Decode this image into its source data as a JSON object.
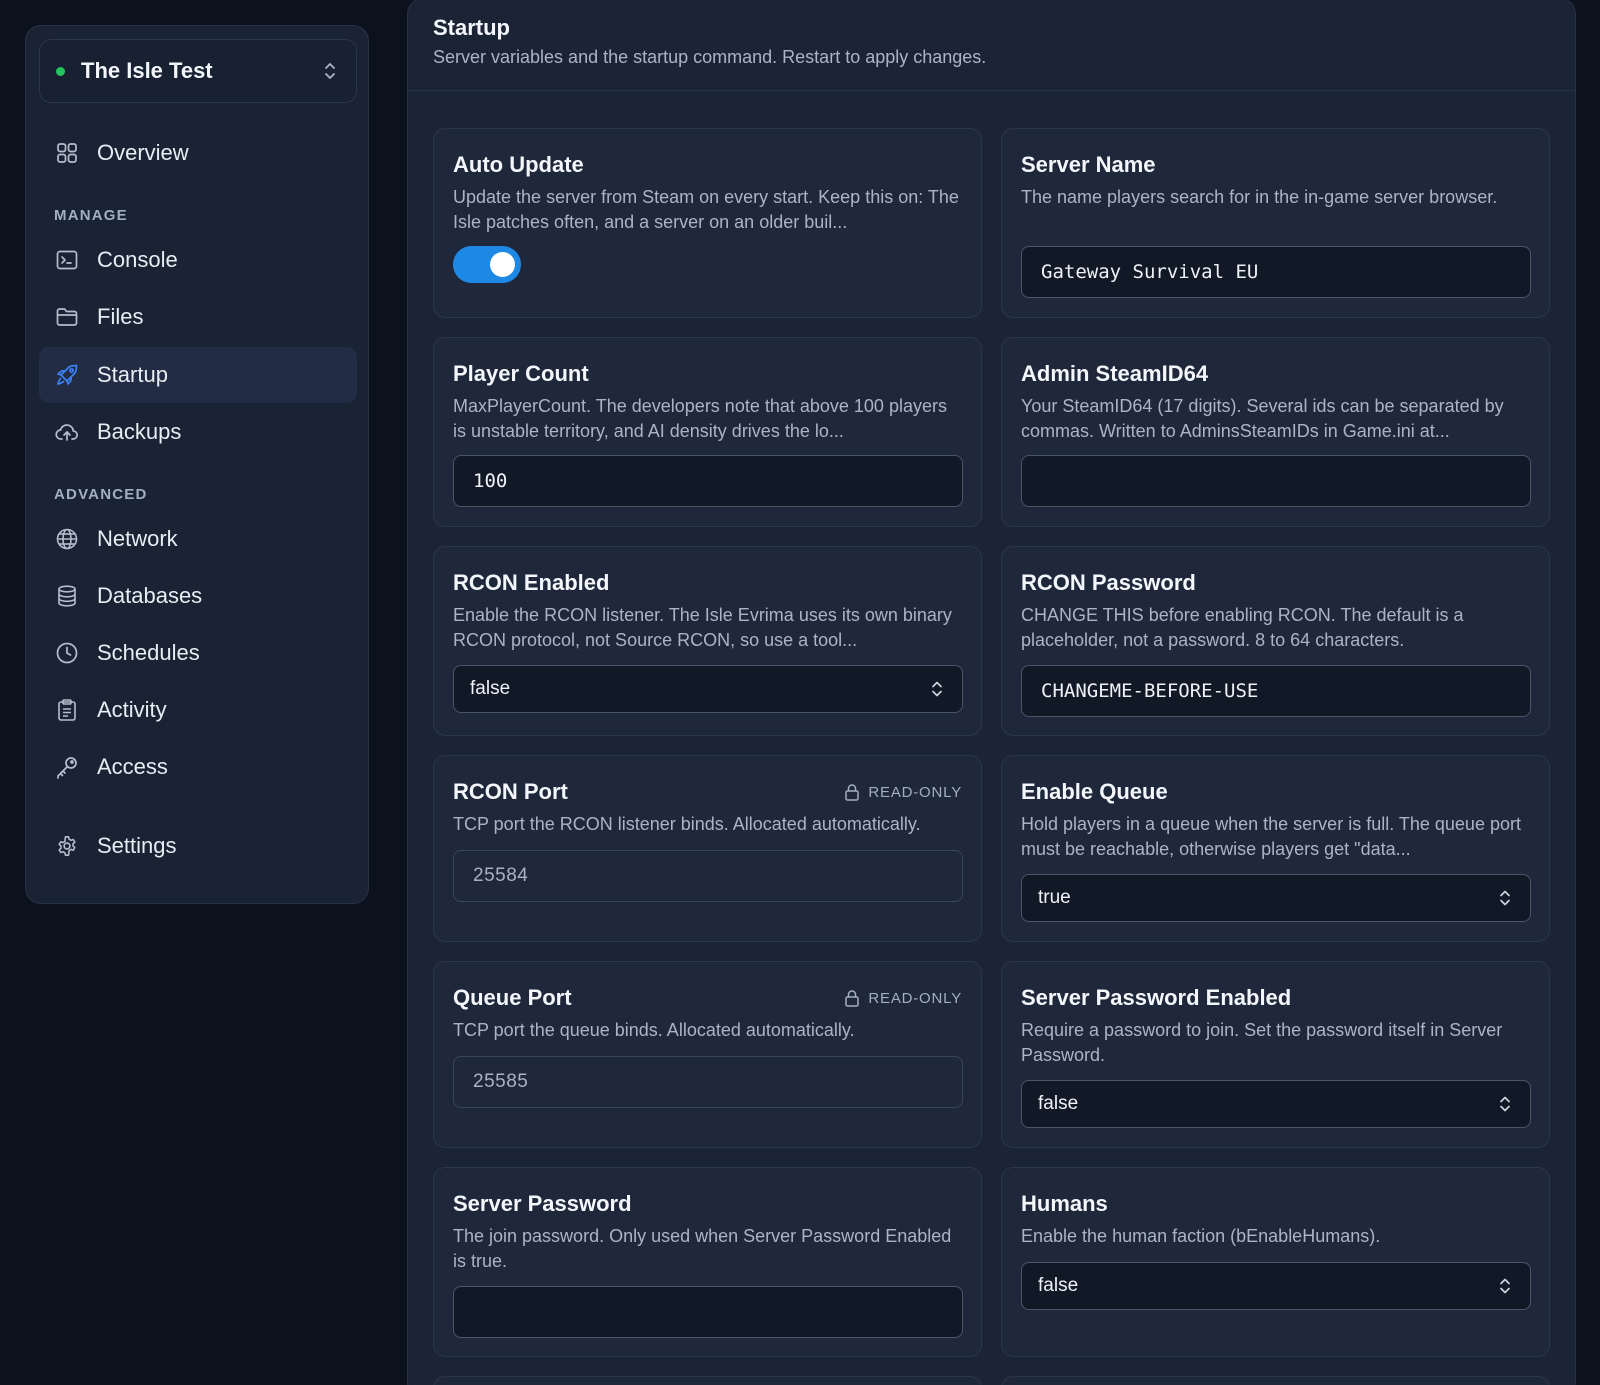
{
  "server_switcher": {
    "name": "The Isle Test",
    "status_color": "#22c55e"
  },
  "nav": {
    "overview": "Overview",
    "manage_heading": "MANAGE",
    "console": "Console",
    "files": "Files",
    "startup": "Startup",
    "backups": "Backups",
    "advanced_heading": "ADVANCED",
    "network": "Network",
    "databases": "Databases",
    "schedules": "Schedules",
    "activity": "Activity",
    "access": "Access",
    "settings": "Settings",
    "active_item": "Startup"
  },
  "page": {
    "title": "Startup",
    "subtitle": "Server variables and the startup command. Restart to apply changes."
  },
  "variables": {
    "auto_update": {
      "title": "Auto Update",
      "description": "Update the server from Steam on every start. Keep this on: The Isle patches often, and a server on an older buil...",
      "enabled": true
    },
    "server_name": {
      "title": "Server Name",
      "description": "The name players search for in the in-game server browser.",
      "value": "Gateway Survival EU"
    },
    "player_count": {
      "title": "Player Count",
      "description": "MaxPlayerCount. The developers note that above 100 players is unstable territory, and AI density drives the lo...",
      "value": "100"
    },
    "admin_steamid": {
      "title": "Admin SteamID64",
      "description": "Your SteamID64 (17 digits). Several ids can be separated by commas. Written to AdminsSteamIDs in Game.ini at...",
      "value": ""
    },
    "rcon_enabled": {
      "title": "RCON Enabled",
      "description": "Enable the RCON listener. The Isle Evrima uses its own binary RCON protocol, not Source RCON, so use a tool...",
      "value": "false"
    },
    "rcon_password": {
      "title": "RCON Password",
      "description": "CHANGE THIS before enabling RCON. The default is a placeholder, not a password. 8 to 64 characters.",
      "value": "CHANGEME-BEFORE-USE"
    },
    "rcon_port": {
      "title": "RCON Port",
      "badge": "READ-ONLY",
      "description": "TCP port the RCON listener binds. Allocated automatically.",
      "value": "25584"
    },
    "enable_queue": {
      "title": "Enable Queue",
      "description": "Hold players in a queue when the server is full. The queue port must be reachable, otherwise players get \"data...",
      "value": "true"
    },
    "queue_port": {
      "title": "Queue Port",
      "badge": "READ-ONLY",
      "description": "TCP port the queue binds. Allocated automatically.",
      "value": "25585"
    },
    "server_password_enabled": {
      "title": "Server Password Enabled",
      "description": "Require a password to join. Set the password itself in Server Password.",
      "value": "false"
    },
    "server_password": {
      "title": "Server Password",
      "description": "The join password. Only used when Server Password Enabled is true.",
      "value": ""
    },
    "humans": {
      "title": "Humans",
      "description": "Enable the human faction (bEnableHumans).",
      "value": "false"
    }
  },
  "icons": {
    "overview": "grid-icon",
    "console": "terminal-icon",
    "files": "folder-icon",
    "startup": "rocket-icon",
    "backups": "cloud-upload-icon",
    "network": "globe-icon",
    "databases": "database-icon",
    "schedules": "clock-icon",
    "activity": "clipboard-icon",
    "access": "key-icon",
    "settings": "gear-icon",
    "readonly": "lock-icon",
    "select": "chevron-up-down-icon"
  },
  "colors": {
    "accent": "#3b82f6",
    "toggle_on": "#1e88e5",
    "status_online": "#22c55e"
  }
}
